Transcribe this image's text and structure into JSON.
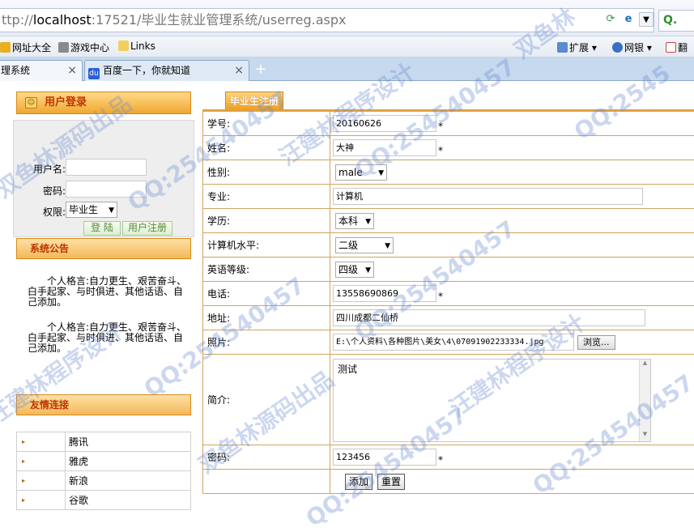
{
  "browser": {
    "url_prefix": "ttp://",
    "url_host": "localhost",
    "url_rest": ":17521/毕业生就业管理系统/userreg.aspx",
    "search_text": "Q.",
    "favorites": [
      "网址大全",
      "游戏中心",
      "Links"
    ],
    "toolbar_right": [
      "扩展",
      "网银",
      "翻"
    ],
    "tabs": [
      {
        "label": "理系统",
        "close": "×"
      },
      {
        "label": "百度一下，你就知道",
        "close": "×"
      }
    ],
    "new_tab": "+"
  },
  "login": {
    "title": "用户登录",
    "username_label": "用户名:",
    "password_label": "密码:",
    "role_label": "权限:",
    "role_value": "毕业生",
    "login_button": "登 陆",
    "register_button": "用户注册"
  },
  "notice": {
    "title": "系统公告",
    "paragraphs": [
      "个人格言:自力更生、艰苦奋斗、白手起家、与时俱进、其他话语、自己添加。",
      "个人格言:自力更生、艰苦奋斗、白手起家、与时俱进、其他话语、自己添加。"
    ]
  },
  "links": {
    "title": "友情连接",
    "items": [
      "腾讯",
      "雅虎",
      "新浪",
      "谷歌"
    ]
  },
  "form": {
    "tab_label": "毕业生注册",
    "fields": {
      "student_id": {
        "label": "学号:",
        "value": "20160626"
      },
      "name": {
        "label": "姓名:",
        "value": "大神"
      },
      "gender": {
        "label": "性别:",
        "value": "male"
      },
      "major": {
        "label": "专业:",
        "value": "计算机"
      },
      "education": {
        "label": "学历:",
        "value": "本科"
      },
      "computer_level": {
        "label": "计算机水平:",
        "value": "二级"
      },
      "english_level": {
        "label": "英语等级:",
        "value": "四级"
      },
      "phone": {
        "label": "电话:",
        "value": "13558690869"
      },
      "address": {
        "label": "地址:",
        "value": "四川成都二仙桥"
      },
      "photo": {
        "label": "照片:",
        "value": "E:\\个人资料\\各种图片\\美女\\4\\07091902233334.jpg",
        "browse": "浏览..."
      },
      "intro": {
        "label": "简介:",
        "value": "测试"
      },
      "password": {
        "label": "密码:",
        "value": "123456"
      }
    },
    "required_mark": "*",
    "submit_button": "添加",
    "reset_button": "重置"
  },
  "watermark": {
    "texts": [
      "双鱼林源码出品",
      "汪建林程序设计",
      "QQ:254540457",
      "双鱼林",
      "QQ:2545"
    ]
  }
}
